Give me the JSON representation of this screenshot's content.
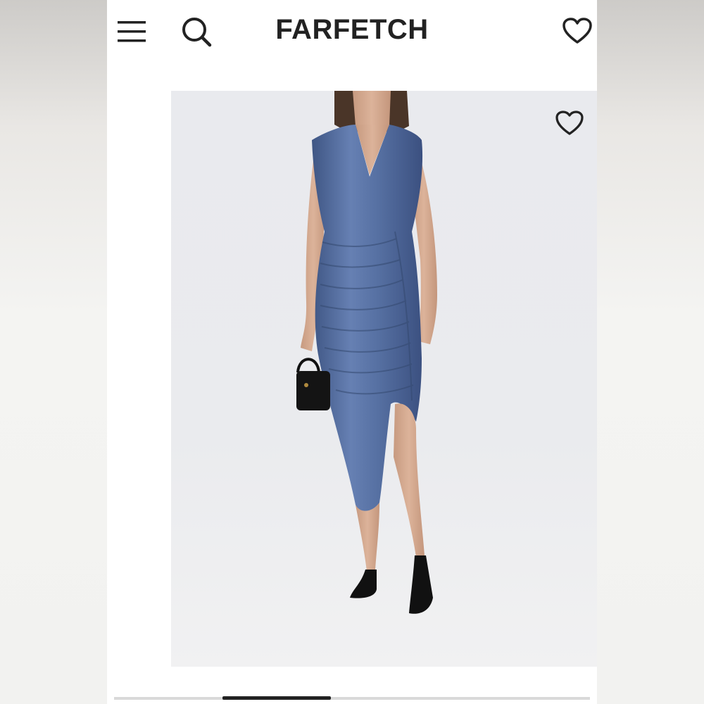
{
  "app": {
    "brand": "FARFETCH"
  },
  "header": {
    "icons": [
      "menu-icon",
      "search-icon",
      "heart-icon"
    ]
  },
  "product": {
    "wishlist_icon": "heart-icon",
    "image_subject": "dress"
  },
  "colors": {
    "logo": "#222222",
    "dress": "#5b73a3",
    "background": "#ffffff"
  },
  "scroll": {
    "position_fraction": 0.24
  }
}
